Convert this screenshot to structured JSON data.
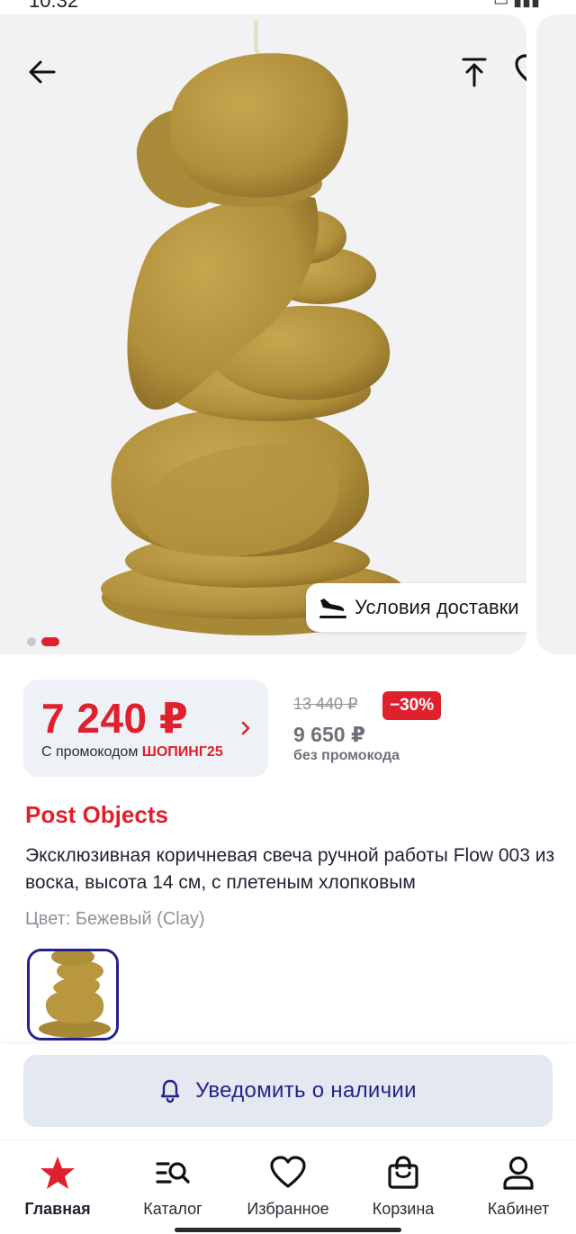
{
  "status_bar": {
    "time": "10:32"
  },
  "gallery": {
    "slide_count": 2,
    "active_slide": 1,
    "delivery_label": "Условия доставки"
  },
  "price": {
    "main": "7 240 ₽",
    "promo_prefix": "С промокодом",
    "promo_code": "ШОПИНГ25",
    "old": "13 440 ₽",
    "discount": "−30%",
    "without_promo": "9 650 ₽",
    "without_promo_label": "без промокода"
  },
  "product": {
    "brand": "Post Objects",
    "title": "Эксклюзивная коричневая свеча ручной работы Flow 003 из воска, высота 14 см, с плетеным хлопковым",
    "color_label": "Цвет: Бежевый (Clay)"
  },
  "notify": {
    "label": "Уведомить о наличии"
  },
  "nav": [
    {
      "label": "Главная",
      "icon": "star-icon",
      "active": true
    },
    {
      "label": "Каталог",
      "icon": "catalog-search-icon",
      "active": false
    },
    {
      "label": "Избранное",
      "icon": "heart-icon",
      "active": false
    },
    {
      "label": "Корзина",
      "icon": "shopping-bag-icon",
      "active": false
    },
    {
      "label": "Кабинет",
      "icon": "user-icon",
      "active": false
    }
  ],
  "colors": {
    "accent": "#e0202d",
    "brand_blue": "#24228a",
    "candle": "#b8973f",
    "gallery_bg": "#f2f2f4"
  }
}
